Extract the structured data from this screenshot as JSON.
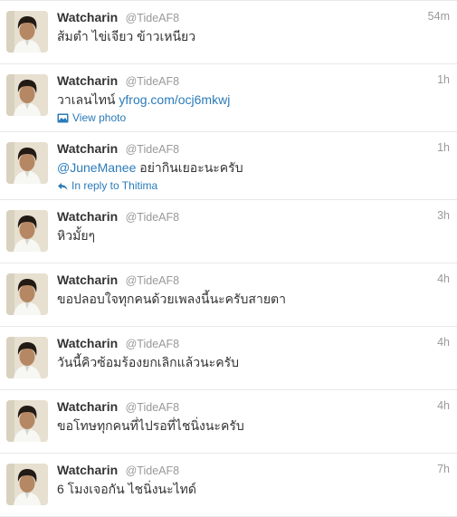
{
  "tweets": [
    {
      "name": "Watcharin",
      "handle": "@TideAF8",
      "time": "54m",
      "text": "ส้มตำ ไข่เจียว ข้าวเหนียว"
    },
    {
      "name": "Watcharin",
      "handle": "@TideAF8",
      "time": "1h",
      "text": "วาเลนไทน์",
      "link": "yfrog.com/ocj6mkwj",
      "meta": "View photo",
      "meta_icon": "photo-icon"
    },
    {
      "name": "Watcharin",
      "handle": "@TideAF8",
      "time": "1h",
      "mention": "@JuneManee",
      "text": "อย่ากินเยอะนะครับ",
      "meta": "In reply to Thitima",
      "meta_icon": "reply-arrow-icon"
    },
    {
      "name": "Watcharin",
      "handle": "@TideAF8",
      "time": "3h",
      "text": "หิวมั้ยๆ"
    },
    {
      "name": "Watcharin",
      "handle": "@TideAF8",
      "time": "4h",
      "text": "ขอปลอบใจทุกคนด้วยเพลงนี้นะครับสายตา"
    },
    {
      "name": "Watcharin",
      "handle": "@TideAF8",
      "time": "4h",
      "text": "วันนี้คิวซ้อมร้องยกเลิกแล้วนะครับ"
    },
    {
      "name": "Watcharin",
      "handle": "@TideAF8",
      "time": "4h",
      "text": "ขอโทษทุกคนที่ไปรอที่ไชนิ่งนะครับ"
    },
    {
      "name": "Watcharin",
      "handle": "@TideAF8",
      "time": "7h",
      "text": "6 โมงเจอกัน ไชนิ่งนะไทด์"
    }
  ],
  "colors": {
    "link": "#2b7bb9",
    "name": "#333333",
    "muted": "#999999",
    "divider": "#e8e8e8"
  }
}
